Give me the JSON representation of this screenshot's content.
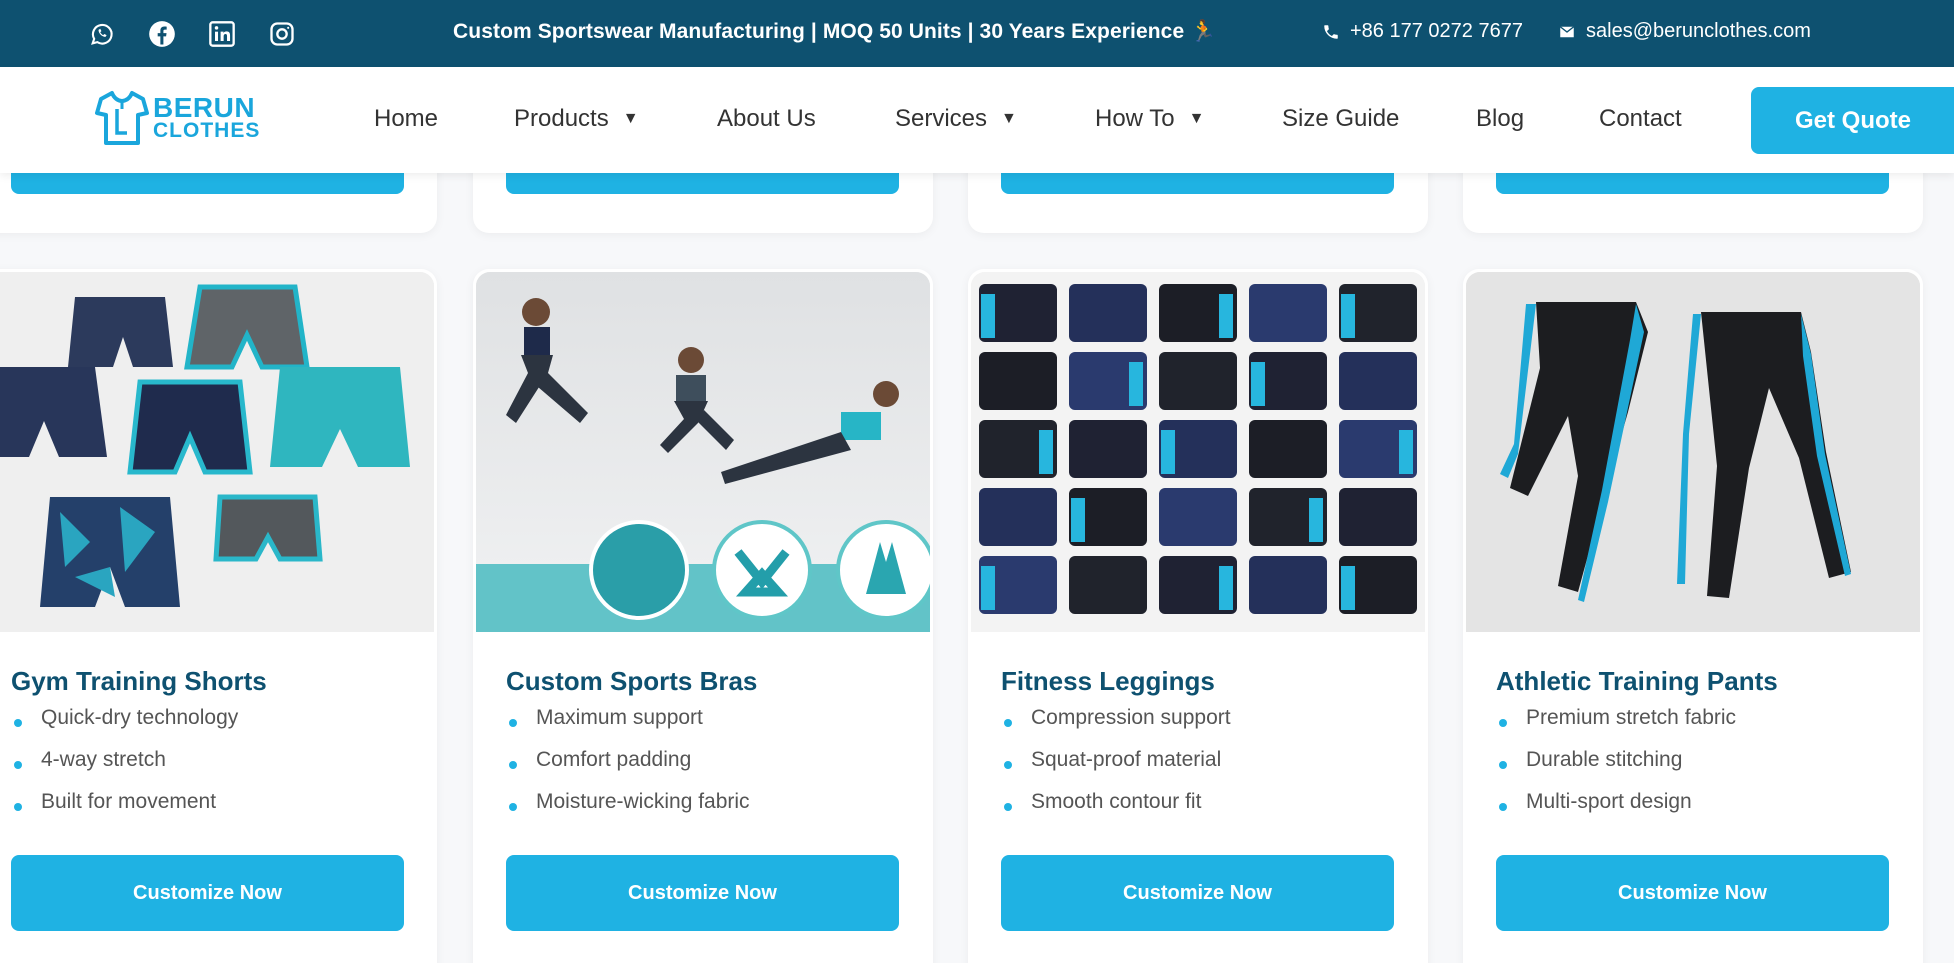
{
  "topbar": {
    "tagline": "Custom Sportswear Manufacturing | MOQ 50 Units | 30 Years Experience 🏃",
    "phone": "+86 177 0272 7677",
    "email": "sales@berunclothes.com",
    "social_icons": [
      "whatsapp-icon",
      "facebook-icon",
      "linkedin-icon",
      "instagram-icon"
    ]
  },
  "header": {
    "logo": {
      "line1": "BERUN",
      "line2": "CLOTHES"
    },
    "nav": [
      {
        "label": "Home",
        "dropdown": false
      },
      {
        "label": "Products",
        "dropdown": true
      },
      {
        "label": "About Us",
        "dropdown": false
      },
      {
        "label": "Services",
        "dropdown": true
      },
      {
        "label": "How To",
        "dropdown": true
      },
      {
        "label": "Size Guide",
        "dropdown": false
      },
      {
        "label": "Blog",
        "dropdown": false
      },
      {
        "label": "Contact",
        "dropdown": false
      }
    ],
    "caret": "▼",
    "cta": "Get Quote"
  },
  "colors": {
    "topbar_bg": "#0e5170",
    "accent": "#1fb2e3",
    "title": "#0e5170",
    "teal": "#27b3c4"
  },
  "products": [
    {
      "title": "Gym Training Shorts",
      "features": [
        "Quick-dry technology",
        "4-way stretch",
        "Built for movement"
      ],
      "button": "Customize Now",
      "image": "shorts-image"
    },
    {
      "title": "Custom Sports Bras",
      "features": [
        "Maximum support",
        "Comfort padding",
        "Moisture-wicking fabric"
      ],
      "button": "Customize Now",
      "image": "sports-bras-image"
    },
    {
      "title": "Fitness Leggings",
      "features": [
        "Compression support",
        "Squat-proof material",
        "Smooth contour fit"
      ],
      "button": "Customize Now",
      "image": "leggings-image"
    },
    {
      "title": "Athletic Training Pants",
      "features": [
        "Premium stretch fabric",
        "Durable stitching",
        "Multi-sport design"
      ],
      "button": "Customize Now",
      "image": "training-pants-image"
    }
  ]
}
